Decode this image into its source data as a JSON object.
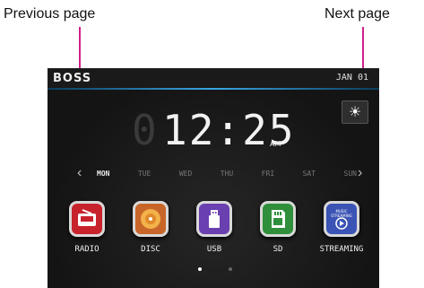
{
  "callouts": {
    "prev": "Previous page",
    "next": "Next page"
  },
  "header": {
    "logo": "BOSS",
    "date": "JAN 01"
  },
  "clock": {
    "time": "12:25",
    "ampm": "AM",
    "ghost_digit": "0"
  },
  "brightness_icon": "sun-icon",
  "days": [
    "MON",
    "TUE",
    "WED",
    "THU",
    "FRI",
    "SAT",
    "SUN"
  ],
  "active_day": "MON",
  "nav": {
    "left": "‹",
    "right": "›"
  },
  "apps": [
    {
      "label": "RADIO",
      "icon": "radio-icon",
      "color": "#c8232c"
    },
    {
      "label": "DISC",
      "icon": "disc-icon",
      "color": "#c8662a"
    },
    {
      "label": "USB",
      "icon": "usb-icon",
      "color": "#6a3fb0"
    },
    {
      "label": "SD",
      "icon": "sd-card-icon",
      "color": "#2f8f3a"
    },
    {
      "label": "STREAMING",
      "icon": "music-streaming-icon",
      "color": "#3b53b5",
      "badge": "MUSIC STREAMING"
    }
  ],
  "pager": {
    "pages": 2,
    "current": 1
  },
  "accent": "#d0208a"
}
